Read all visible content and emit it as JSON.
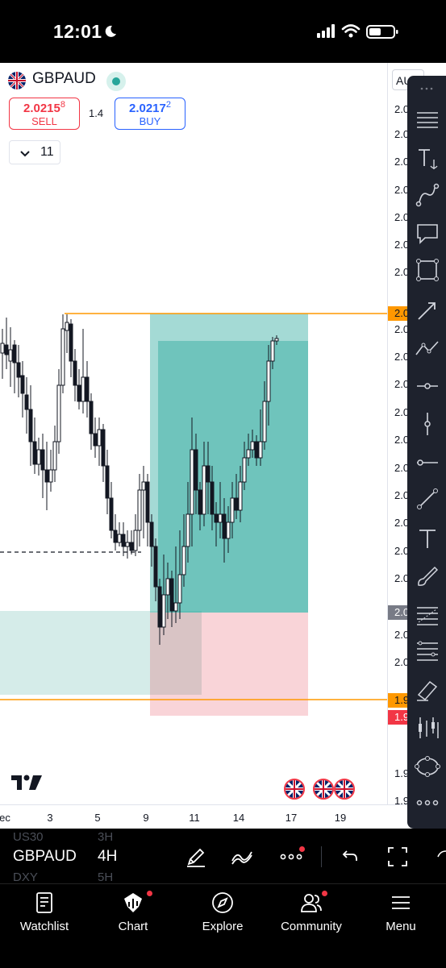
{
  "status_bar": {
    "time": "12:01"
  },
  "header": {
    "symbol": "GBPAUD",
    "sell": {
      "price_main": "2.0215",
      "price_sup": "8",
      "label": "SELL"
    },
    "buy": {
      "price_main": "2.0217",
      "price_sup": "2",
      "label": "BUY"
    },
    "spread": "1.4",
    "indicators_count": "11"
  },
  "price_axis": {
    "symbol_button": "AUD",
    "labels": [
      "2.0",
      "2.0",
      "2.0",
      "2.0",
      "2.0",
      "2.0",
      "2.0",
      "2.0",
      "2.0",
      "2.0",
      "2.0",
      "2.0",
      "2.0",
      "2.0",
      "2.0",
      "2.0",
      "2.0",
      "2.0",
      "2.0",
      "2.0",
      "1.9",
      "1.9",
      "1.9",
      "1.9"
    ],
    "badges": {
      "orange_top": "2.0",
      "gray": "2.0",
      "orange_bottom": "1.9",
      "red": "1.9"
    }
  },
  "time_axis": {
    "labels": [
      "ec",
      "3",
      "5",
      "9",
      "11",
      "14",
      "17",
      "19"
    ]
  },
  "bottom_bar": {
    "symbol": "GBPAUD",
    "timeframe": "4H",
    "ghost_symbols": [
      "US30",
      "DXY"
    ],
    "ghost_timeframes": [
      "3H",
      "5H"
    ]
  },
  "nav": {
    "items": [
      {
        "label": "Watchlist",
        "icon": "watchlist-icon"
      },
      {
        "label": "Chart",
        "icon": "chart-icon"
      },
      {
        "label": "Explore",
        "icon": "compass-icon"
      },
      {
        "label": "Community",
        "icon": "community-icon"
      },
      {
        "label": "Menu",
        "icon": "menu-icon"
      }
    ]
  },
  "colors": {
    "bull": "#131722",
    "target_zone": "#26a69a",
    "stop_zone": "#f7c5cb",
    "level_line": "#ff9800",
    "sell": "#f23645",
    "buy": "#2962ff",
    "toolbar_bg": "#1e222d"
  },
  "drawing_tools": [
    "menu-lines-icon",
    "text-anchor-icon",
    "path-icon",
    "callout-icon",
    "rectangle-icon",
    "arrow-icon",
    "zigzag-icon",
    "horizontal-ray-icon",
    "vertical-line-icon",
    "horizontal-line-icon",
    "trend-line-icon",
    "text-icon",
    "brush-icon",
    "fib-retracement-icon",
    "fib-extension-icon",
    "highlighter-icon",
    "bars-pattern-icon",
    "ellipse-icon",
    "more-icon"
  ]
}
